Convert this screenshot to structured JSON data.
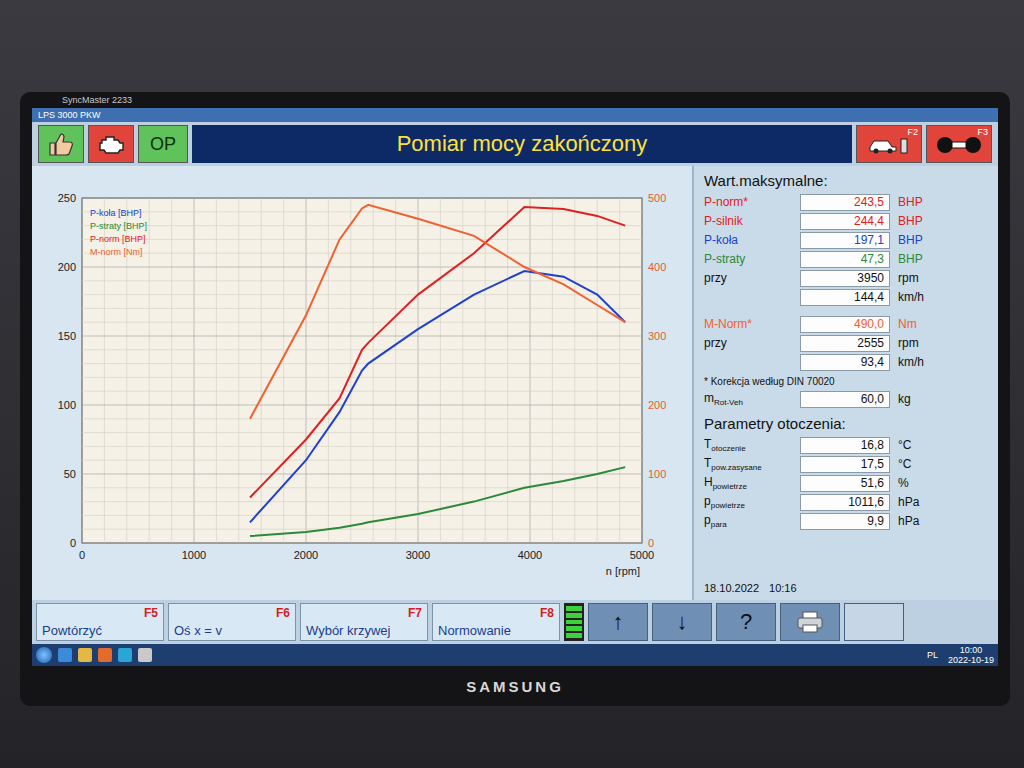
{
  "monitor": {
    "model": "SyncMaster 2233",
    "brand": "SAMSUNG"
  },
  "window": {
    "title": "LPS 3000 PKW"
  },
  "toolbar": {
    "op_label": "OP",
    "title": "Pomiar mocy zakończony",
    "keys": [
      "F2",
      "F3"
    ]
  },
  "chart": {
    "rpm": [
      1500,
      2000,
      2300,
      2500,
      2555,
      3000,
      3500,
      3950,
      4300,
      4600,
      4850
    ],
    "series": [
      {
        "name": "P-koła [BHP]",
        "color": "#2040d0",
        "axis": "left",
        "values": [
          15,
          60,
          95,
          125,
          130,
          155,
          180,
          197.1,
          193,
          180,
          160
        ]
      },
      {
        "name": "P-straty [BHP]",
        "color": "#2a8a3a",
        "axis": "left",
        "values": [
          5,
          8,
          11,
          14,
          15,
          21,
          30,
          40,
          45,
          50,
          55
        ]
      },
      {
        "name": "P-norm [BHP]",
        "color": "#e02020",
        "axis": "left",
        "values": [
          33,
          75,
          105,
          140,
          145,
          180,
          210,
          243.5,
          242,
          237,
          230
        ]
      },
      {
        "name": "M-norm [Nm]",
        "color": "#f06030",
        "axis": "right",
        "values": [
          180,
          330,
          440,
          485,
          490,
          470,
          445,
          400,
          375,
          345,
          320
        ]
      }
    ],
    "left_ticks": [
      "0",
      "50",
      "100",
      "150",
      "200",
      "250"
    ],
    "right_ticks": [
      "0",
      "100",
      "200",
      "300",
      "400",
      "500"
    ],
    "x_ticks": [
      "0",
      "1000",
      "2000",
      "3000",
      "4000",
      "5000"
    ],
    "x_label": "n [rpm]"
  },
  "max_values": {
    "title": "Wart.maksymalne:",
    "power_rows": [
      {
        "label": "P-norm*",
        "value": "243,5",
        "unit": "BHP",
        "color": "#e02020"
      },
      {
        "label": "P-silnik",
        "value": "244,4",
        "unit": "BHP",
        "color": "#e02020"
      },
      {
        "label": "P-koła",
        "value": "197,1",
        "unit": "BHP",
        "color": "#2040d0"
      },
      {
        "label": "P-straty",
        "value": "47,3",
        "unit": "BHP",
        "color": "#2a8a3a"
      },
      {
        "label": "przy",
        "value": "3950",
        "unit": "rpm",
        "color": "#111111"
      },
      {
        "label": "",
        "value": "144,4",
        "unit": "km/h",
        "color": "#111111"
      }
    ],
    "torque_rows": [
      {
        "label": "M-Norm*",
        "value": "490,0",
        "unit": "Nm",
        "color": "#f06030"
      },
      {
        "label": "przy",
        "value": "2555",
        "unit": "rpm",
        "color": "#111111"
      },
      {
        "label": "",
        "value": "93,4",
        "unit": "km/h",
        "color": "#111111"
      }
    ],
    "note": "* Korekcja według DIN 70020",
    "mass": {
      "symbol": "m",
      "sub": "Rot-Veh",
      "value": "60,0",
      "unit": "kg"
    }
  },
  "ambient": {
    "title": "Parametry otoczenia:",
    "rows": [
      {
        "symbol": "T",
        "sub": "otoczenie",
        "value": "16,8",
        "unit": "°C"
      },
      {
        "symbol": "T",
        "sub": "pow.zasysane",
        "value": "17,5",
        "unit": "°C"
      },
      {
        "symbol": "H",
        "sub": "powietrze",
        "value": "51,6",
        "unit": "%"
      },
      {
        "symbol": "p",
        "sub": "powietrze",
        "value": "1011,6",
        "unit": "hPa"
      },
      {
        "symbol": "p",
        "sub": "para",
        "value": "9,9",
        "unit": "hPa"
      }
    ]
  },
  "timestamp": {
    "date": "18.10.2022",
    "time": "10:16"
  },
  "fkeys": [
    {
      "label": "Powtórzyć",
      "key": "F5"
    },
    {
      "label": "Oś x = v",
      "key": "F6"
    },
    {
      "label": "Wybór krzywej",
      "key": "F7"
    },
    {
      "label": "Normowanie",
      "key": "F8"
    }
  ],
  "indicator": {
    "level": 1
  },
  "nav_buttons": [
    "↑",
    "↓",
    "?"
  ],
  "taskbar": {
    "language": "PL",
    "time": "10:00",
    "date": "2022-10-19"
  }
}
